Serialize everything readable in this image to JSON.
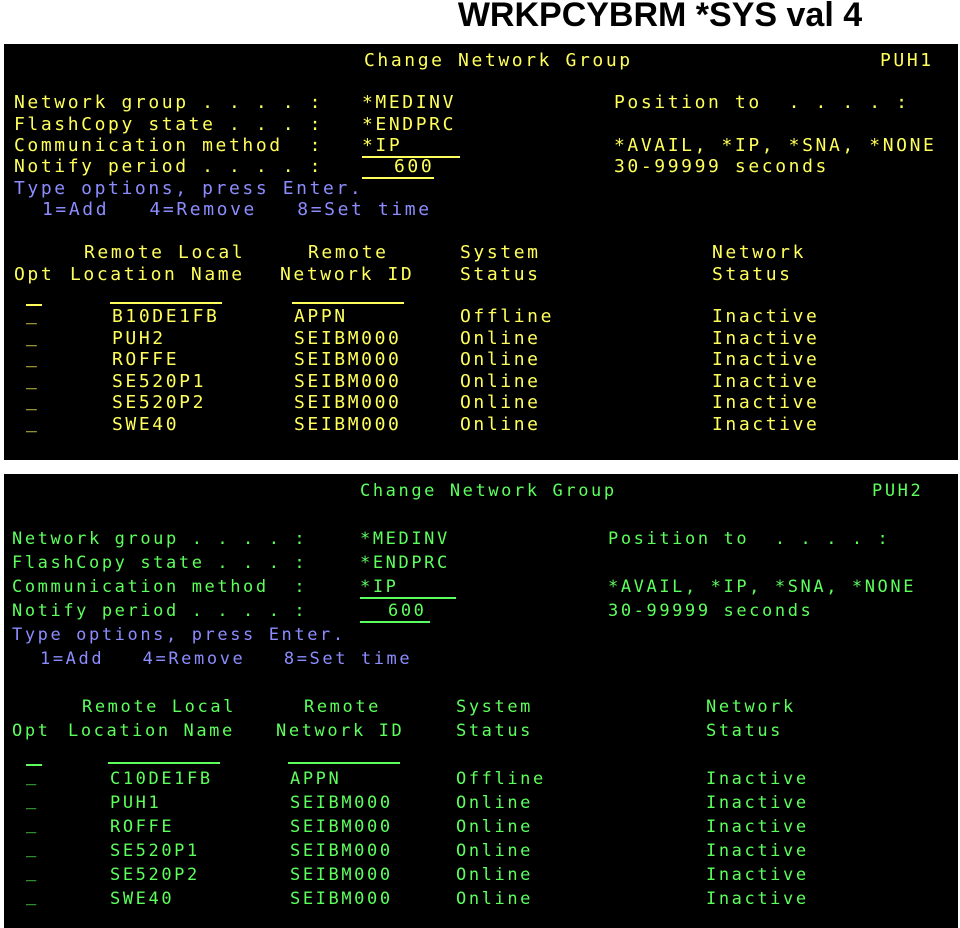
{
  "slide_title": "WRKPCYBRM *SYS val 4",
  "screens": [
    {
      "id": "top",
      "colors": {
        "text": "#ffff5c",
        "field": "#ffff5c",
        "info": "#8c8cff"
      },
      "screen_title": "Change Network Group",
      "system_name": "PUH1",
      "fields": {
        "network_group_label": "Network group . . . . :",
        "network_group_value": "*MEDINV",
        "flashcopy_label": "FlashCopy state . . . :",
        "flashcopy_value": "*ENDPRC",
        "comm_method_label": "Communication method  :",
        "comm_method_value": "*IP",
        "notify_label": "Notify period . . . . :",
        "notify_value": "600",
        "position_label": "Position to  . . . . :",
        "comm_hint": "*AVAIL, *IP, *SNA, *NONE",
        "notify_hint": "30-99999 seconds"
      },
      "instructions": "Type options, press Enter.",
      "options": "1=Add   4=Remove   8=Set time",
      "headers": {
        "h1_col2": "Remote Local",
        "h1_col3": "Remote",
        "h1_col4": "System",
        "h1_col5": "Network",
        "h2_col1": "Opt",
        "h2_col2": "Location Name",
        "h2_col3": "Network ID",
        "h2_col4": "Status",
        "h2_col5": "Status"
      },
      "rows": [
        {
          "opt": "_",
          "location": "B10DE1FB",
          "network_id": "APPN",
          "system_status": "Offline",
          "network_status": "Inactive"
        },
        {
          "opt": "_",
          "location": "PUH2",
          "network_id": "SEIBM000",
          "system_status": "Online",
          "network_status": "Inactive"
        },
        {
          "opt": "_",
          "location": "ROFFE",
          "network_id": "SEIBM000",
          "system_status": "Online",
          "network_status": "Inactive"
        },
        {
          "opt": "_",
          "location": "SE520P1",
          "network_id": "SEIBM000",
          "system_status": "Online",
          "network_status": "Inactive"
        },
        {
          "opt": "_",
          "location": "SE520P2",
          "network_id": "SEIBM000",
          "system_status": "Online",
          "network_status": "Inactive"
        },
        {
          "opt": "_",
          "location": "SWE40",
          "network_id": "SEIBM000",
          "system_status": "Online",
          "network_status": "Inactive"
        }
      ]
    },
    {
      "id": "bottom",
      "colors": {
        "text": "#5cff5c",
        "field": "#5cff5c",
        "info": "#8c8cff"
      },
      "screen_title": "Change Network Group",
      "system_name": "PUH2",
      "fields": {
        "network_group_label": "Network group . . . . :",
        "network_group_value": "*MEDINV",
        "flashcopy_label": "FlashCopy state . . . :",
        "flashcopy_value": "*ENDPRC",
        "comm_method_label": "Communication method  :",
        "comm_method_value": "*IP",
        "notify_label": "Notify period . . . . :",
        "notify_value": "600",
        "position_label": "Position to  . . . . :",
        "comm_hint": "*AVAIL, *IP, *SNA, *NONE",
        "notify_hint": "30-99999 seconds"
      },
      "instructions": "Type options, press Enter.",
      "options": "1=Add   4=Remove   8=Set time",
      "headers": {
        "h1_col2": "Remote Local",
        "h1_col3": "Remote",
        "h1_col4": "System",
        "h1_col5": "Network",
        "h2_col1": "Opt",
        "h2_col2": "Location Name",
        "h2_col3": "Network ID",
        "h2_col4": "Status",
        "h2_col5": "Status"
      },
      "rows": [
        {
          "opt": "_",
          "location": "C10DE1FB",
          "network_id": "APPN",
          "system_status": "Offline",
          "network_status": "Inactive"
        },
        {
          "opt": "_",
          "location": "PUH1",
          "network_id": "SEIBM000",
          "system_status": "Online",
          "network_status": "Inactive"
        },
        {
          "opt": "_",
          "location": "ROFFE",
          "network_id": "SEIBM000",
          "system_status": "Online",
          "network_status": "Inactive"
        },
        {
          "opt": "_",
          "location": "SE520P1",
          "network_id": "SEIBM000",
          "system_status": "Online",
          "network_status": "Inactive"
        },
        {
          "opt": "_",
          "location": "SE520P2",
          "network_id": "SEIBM000",
          "system_status": "Online",
          "network_status": "Inactive"
        },
        {
          "opt": "_",
          "location": "SWE40",
          "network_id": "SEIBM000",
          "system_status": "Online",
          "network_status": "Inactive"
        }
      ]
    }
  ]
}
